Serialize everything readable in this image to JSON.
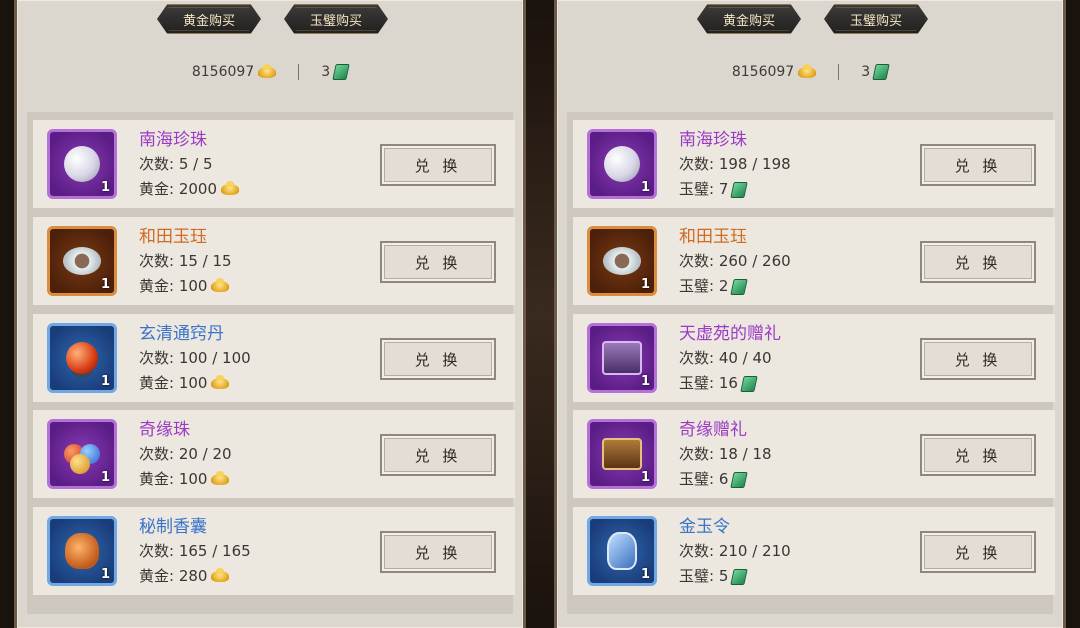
{
  "tabs": {
    "gold": "黄金购买",
    "jade": "玉璧购买"
  },
  "currency": {
    "gold": "8156097",
    "jade": "3"
  },
  "exchange_label": "兑 换",
  "left_panel": [
    {
      "name": "南海珍珠",
      "quality": "purple",
      "icon": "pearl-icon",
      "qty": "1",
      "count_label": "次数: 5 / 5",
      "price_label": "黄金: 2000"
    },
    {
      "name": "和田玉珏",
      "quality": "orange",
      "icon": "jade-ring-icon",
      "qty": "1",
      "count_label": "次数: 15 / 15",
      "price_label": "黄金: 100"
    },
    {
      "name": "玄清通窍丹",
      "quality": "blue",
      "icon": "elixir-pill-icon",
      "qty": "1",
      "count_label": "次数: 100 / 100",
      "price_label": "黄金: 100"
    },
    {
      "name": "奇缘珠",
      "quality": "purple",
      "icon": "fortune-beads-icon",
      "qty": "1",
      "count_label": "次数: 20 / 20",
      "price_label": "黄金: 100"
    },
    {
      "name": "秘制香囊",
      "quality": "blue",
      "icon": "sachet-icon",
      "qty": "1",
      "count_label": "次数: 165 / 165",
      "price_label": "黄金: 280"
    }
  ],
  "right_panel": [
    {
      "name": "南海珍珠",
      "quality": "purple",
      "icon": "pearl-icon",
      "qty": "1",
      "count_label": "次数: 198 / 198",
      "price_label": "玉璧: 7"
    },
    {
      "name": "和田玉珏",
      "quality": "orange",
      "icon": "jade-ring-icon",
      "qty": "1",
      "count_label": "次数: 260 / 260",
      "price_label": "玉璧: 2"
    },
    {
      "name": "天虚苑的赠礼",
      "quality": "purple",
      "icon": "gift-chest-icon",
      "qty": "1",
      "count_label": "次数: 40 / 40",
      "price_label": "玉璧: 16"
    },
    {
      "name": "奇缘赠礼",
      "quality": "purple",
      "icon": "treasure-chest-icon",
      "qty": "1",
      "count_label": "次数: 18 / 18",
      "price_label": "玉璧: 6"
    },
    {
      "name": "金玉令",
      "quality": "blue",
      "icon": "jade-token-icon",
      "qty": "1",
      "count_label": "次数: 210 / 210",
      "price_label": "玉璧: 5"
    }
  ]
}
